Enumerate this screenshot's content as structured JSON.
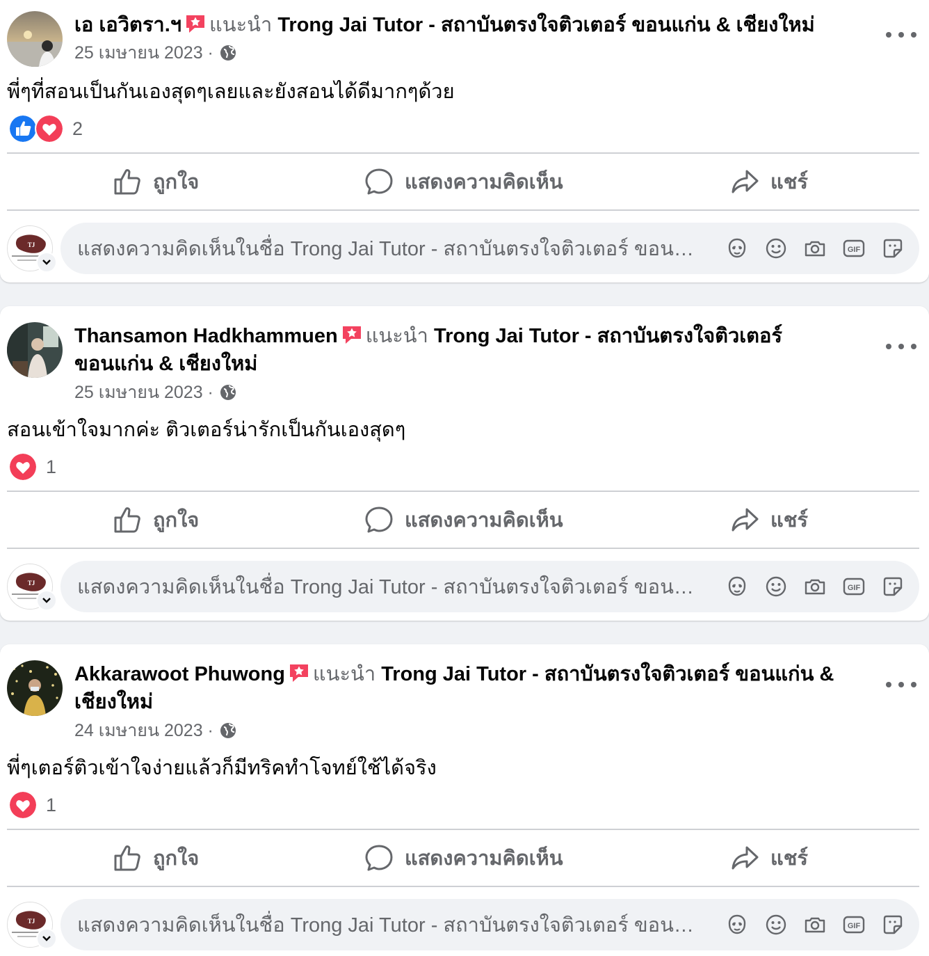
{
  "posts": [
    {
      "author": "เอ เอวิตรา.ฯ",
      "recommends": "แนะนำ",
      "page": "Trong Jai Tutor - สถาบันตรงใจติวเตอร์ ขอนแก่น & เชียงใหม่",
      "date": "25 เมษายน 2023 ·",
      "text": "พี่ๆที่สอนเป็นกันเองสุดๆเลยและยังสอนได้ดีมากๆด้วย",
      "reaction_count": "2"
    },
    {
      "author": "Thansamon Hadkhammuen",
      "recommends": "แนะนำ",
      "page": "Trong Jai Tutor - สถาบันตรงใจติวเตอร์ ขอนแก่น & เชียงใหม่",
      "date": "25 เมษายน 2023 ·",
      "text": "สอนเข้าใจมากค่ะ ติวเตอร์น่ารักเป็นกันเองสุดๆ",
      "reaction_count": "1"
    },
    {
      "author": "Akkarawoot Phuwong",
      "recommends": "แนะนำ",
      "page": "Trong Jai Tutor - สถาบันตรงใจติวเตอร์ ขอนแก่น & เชียงใหม่",
      "date": "24 เมษายน 2023 ·",
      "text": "พี่ๆเตอร์ติวเข้าใจง่ายแล้วก็มีทริคทำโจทย์ใช้ได้จริง",
      "reaction_count": "1"
    }
  ],
  "actions": {
    "like": "ถูกใจ",
    "comment": "แสดงความคิดเห็น",
    "share": "แชร์"
  },
  "comment_placeholder": "แสดงความคิดเห็นในชื่อ Trong Jai Tutor - สถาบันตรงใจติวเตอร์ ขอนแ...",
  "colors": {
    "like_blue": "#1877f2",
    "love_red": "#f33e58",
    "recommend_badge": "#f3425f",
    "muted": "#65676b"
  }
}
